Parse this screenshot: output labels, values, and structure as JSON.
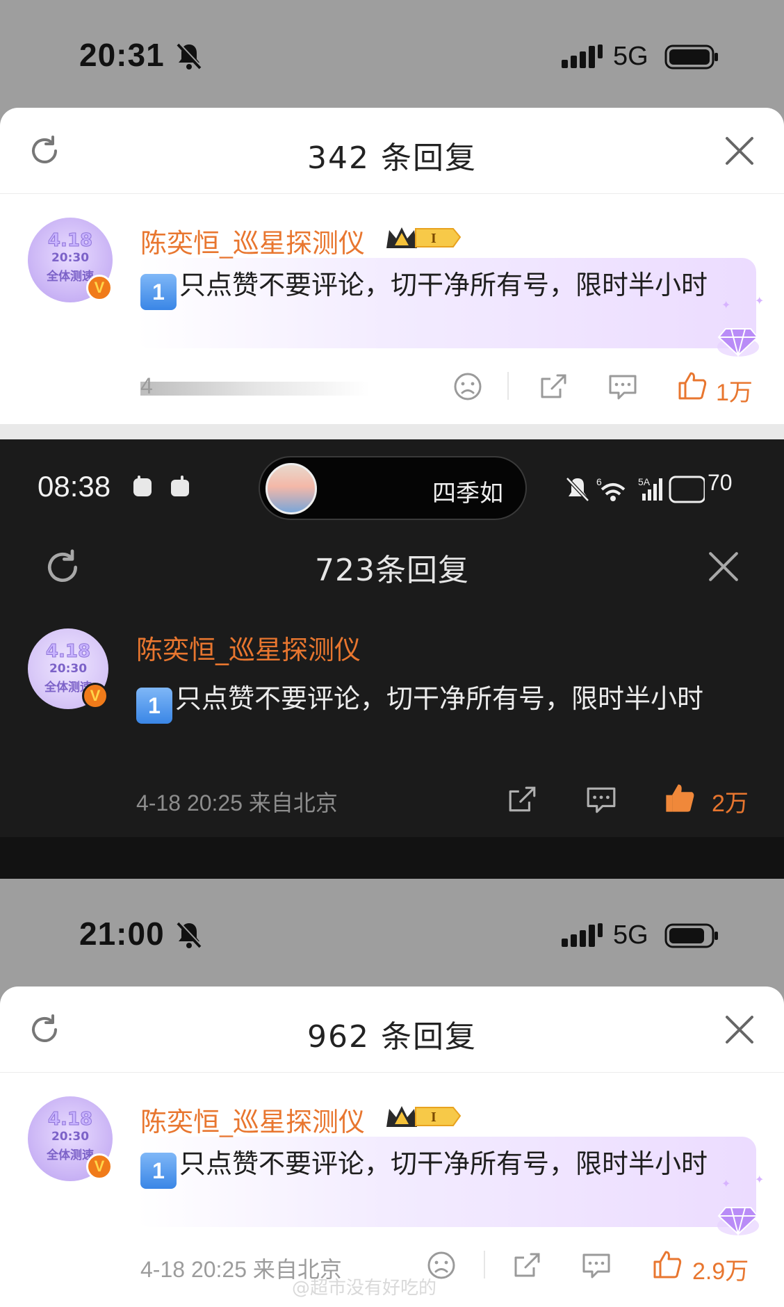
{
  "screens": [
    {
      "status": {
        "time": "20:31",
        "network": "5G"
      },
      "header": {
        "title": "342 条回复",
        "refresh_icon": "refresh-icon",
        "close_icon": "close-icon"
      },
      "comment": {
        "username": "陈奕恒_巡星探测仪",
        "avatar_lines": [
          "4.18",
          "20:30",
          "全体测速"
        ],
        "badge": "V",
        "rank_badge": "I",
        "number_emoji": "1",
        "text": "只点赞不要评论，切干净所有号，限时半小时",
        "meta": "4",
        "likes": "1万"
      }
    },
    {
      "status": {
        "time": "08:38",
        "now_playing": "四季如",
        "battery": "70"
      },
      "header": {
        "title": "723条回复",
        "refresh_icon": "refresh-icon",
        "close_icon": "close-icon"
      },
      "comment": {
        "username": "陈奕恒_巡星探测仪",
        "avatar_lines": [
          "4.18",
          "20:30",
          "全体测速"
        ],
        "badge": "V",
        "number_emoji": "1",
        "text": "只点赞不要评论，切干净所有号，限时半小时",
        "meta": "4-18 20:25 来自北京",
        "likes": "2万"
      }
    },
    {
      "status": {
        "time": "21:00",
        "network": "5G"
      },
      "header": {
        "title": "962 条回复",
        "refresh_icon": "refresh-icon",
        "close_icon": "close-icon"
      },
      "comment": {
        "username": "陈奕恒_巡星探测仪",
        "avatar_lines": [
          "4.18",
          "20:30",
          "全体测速"
        ],
        "badge": "V",
        "rank_badge": "I",
        "number_emoji": "1",
        "text": "只点赞不要评论，切干净所有号，限时半小时",
        "meta": "4-18 20:25 来自北京",
        "likes": "2.9万"
      }
    }
  ],
  "watermark": "@超市没有好吃的",
  "colors": {
    "accent": "#e8762f",
    "light_bg": "#ffffff",
    "dark_bg": "#1b1b1b"
  }
}
